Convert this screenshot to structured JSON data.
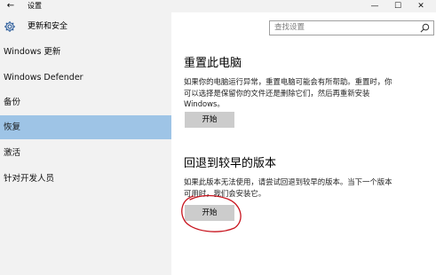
{
  "titlebar": {
    "back_glyph": "←",
    "title": "设置",
    "minimize_glyph": "—",
    "maximize_glyph": "☐",
    "close_glyph": "✕"
  },
  "sidebar": {
    "header_label": "更新和安全",
    "header_icon": "gear-icon",
    "items": [
      {
        "label": "Windows 更新",
        "selected": false
      },
      {
        "label": "Windows Defender",
        "selected": false
      },
      {
        "label": "备份",
        "selected": false
      },
      {
        "label": "恢复",
        "selected": true
      },
      {
        "label": "激活",
        "selected": false
      },
      {
        "label": "针对开发人员",
        "selected": false
      }
    ],
    "selected_color": "#9ec4e6"
  },
  "search": {
    "placeholder": "查找设置",
    "icon": "search-icon"
  },
  "main": {
    "reset": {
      "title": "重置此电脑",
      "desc_line1": "如果你的电脑运行异常，重置电脑可能会有所帮助。重置时，你",
      "desc_line2": "可以选择是保留你的文件还是删除它们，然后再重新安装",
      "desc_line3": "Windows。",
      "button_label": "开始"
    },
    "rollback": {
      "title": "回退到较早的版本",
      "desc_line1": "如果此版本无法使用，请尝试回退到较早的版本。当下一个版本",
      "desc_line2": "可用时，我们会安装它。",
      "button_label": "开始"
    }
  },
  "annotation": {
    "circle_color": "#c8141e"
  }
}
